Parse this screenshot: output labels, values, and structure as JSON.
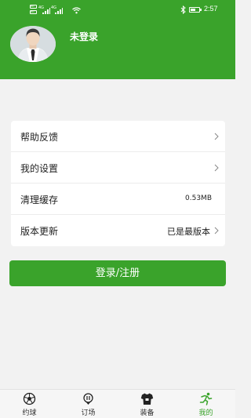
{
  "status_bar": {
    "badge_1": "HD",
    "badge_2": "HD",
    "network_1": "4G",
    "network_2": "4G",
    "time": "2:57"
  },
  "profile": {
    "user_name": "未登录"
  },
  "menu": {
    "items": [
      {
        "label": "帮助反馈",
        "value": ""
      },
      {
        "label": "我的设置",
        "value": ""
      },
      {
        "label": "清理缓存",
        "value": "0.53MB"
      },
      {
        "label": "版本更新",
        "value": "已是最版本"
      }
    ]
  },
  "login_button": "登录/注册",
  "tabs": [
    {
      "label": "约球",
      "icon": "soccer-ball-icon"
    },
    {
      "label": "订场",
      "icon": "whistle-icon"
    },
    {
      "label": "装备",
      "icon": "jersey-icon"
    },
    {
      "label": "我的",
      "icon": "runner-icon"
    }
  ],
  "colors": {
    "brand_green": "#3aa32b",
    "background": "#f2f2f2"
  }
}
